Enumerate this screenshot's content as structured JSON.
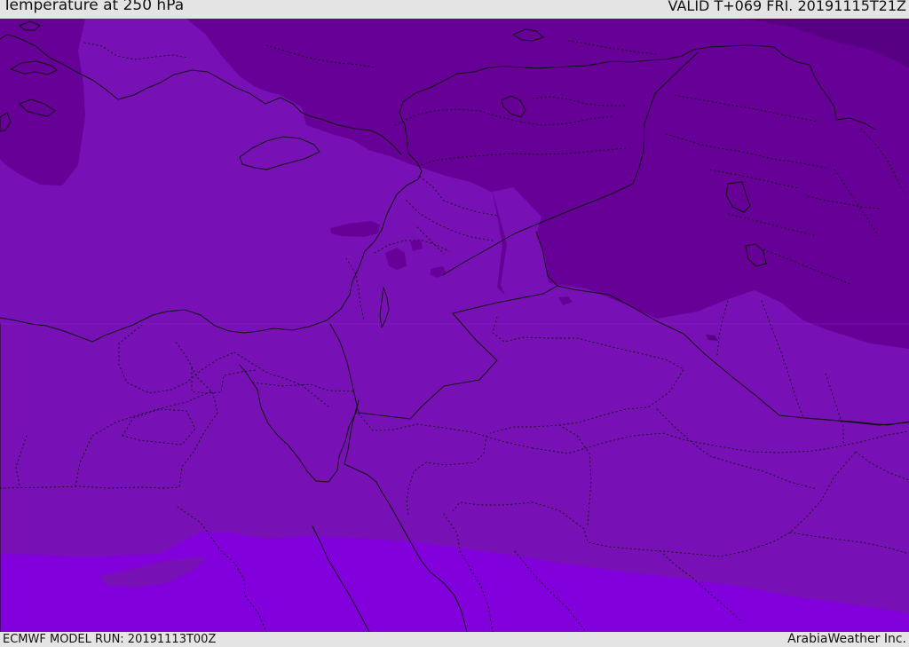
{
  "header": {
    "title": "Temperature at 250 hPa",
    "valid_time": "VALID T+069 FRI. 20191115T21Z"
  },
  "footer": {
    "model_run": "ECMWF MODEL RUN: 20191113T00Z",
    "credit": "ArabiaWeather Inc."
  },
  "colors": {
    "background": "#e4e4e4",
    "band_darkest": "#570083",
    "band_dark": "#670097",
    "band_mid": "#7811b5",
    "band_light": "#8100dc",
    "outline": "#111111"
  },
  "map": {
    "icons": [
      "coastline-icon",
      "country-border-icon",
      "province-border-icon"
    ]
  }
}
